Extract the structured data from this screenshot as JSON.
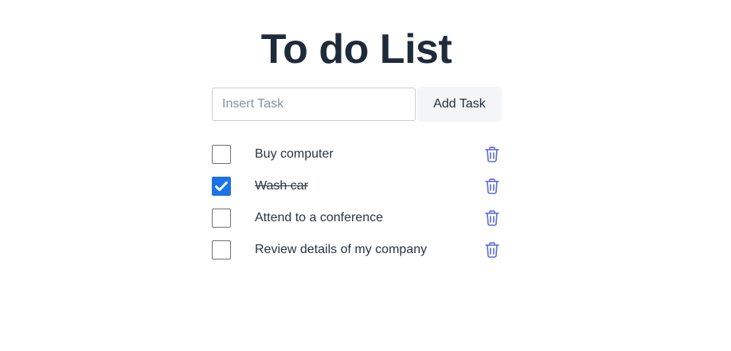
{
  "header": {
    "title": "To do List"
  },
  "new_task": {
    "placeholder": "Insert Task",
    "value": "",
    "add_label": "Add Task"
  },
  "tasks": [
    {
      "label": "Buy computer",
      "done": false
    },
    {
      "label": "Wash car",
      "done": true
    },
    {
      "label": "Attend to a conference",
      "done": false
    },
    {
      "label": "Review details of my company",
      "done": false
    }
  ],
  "colors": {
    "checkbox_checked": "#1a73e8",
    "trash_icon": "#5c6ad6",
    "title": "#1e2b3a"
  },
  "icons": {
    "delete": "trash-icon",
    "check": "checkmark-icon"
  }
}
